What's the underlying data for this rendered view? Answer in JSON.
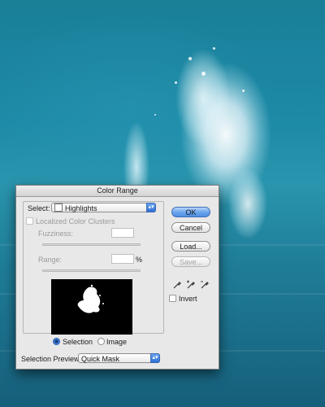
{
  "background": {
    "description_color": "#1d8aa6"
  },
  "dialog": {
    "title": "Color Range",
    "select": {
      "label": "Select:",
      "value": "Highlights"
    },
    "localized_color_clusters": {
      "label": "Localized Color Clusters",
      "checked": false
    },
    "fuzziness": {
      "label": "Fuzziness:",
      "value": ""
    },
    "range": {
      "label": "Range:",
      "value": "",
      "unit": "%"
    },
    "preview_mode": {
      "selection_label": "Selection",
      "image_label": "Image",
      "selected": "Selection"
    },
    "selection_preview": {
      "label": "Selection Preview:",
      "value": "Quick Mask"
    },
    "buttons": {
      "ok": "OK",
      "cancel": "Cancel",
      "load": "Load...",
      "save": "Save..."
    },
    "invert": {
      "label": "Invert",
      "checked": false
    },
    "colors": {
      "accent": "#2f6fd6",
      "dialog_bg": "#e8e8e8"
    }
  }
}
